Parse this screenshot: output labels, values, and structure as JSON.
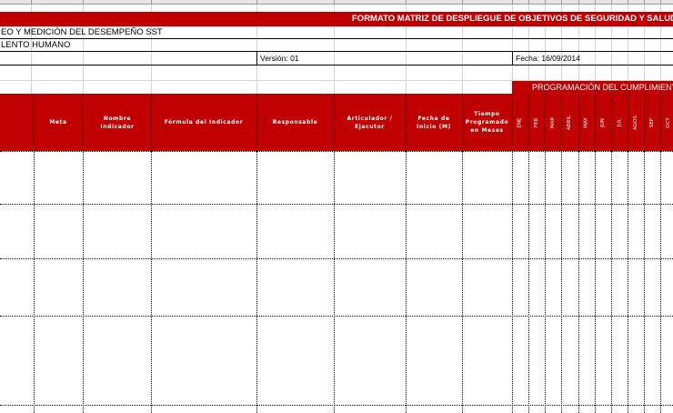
{
  "sheet": {
    "title": "FORMATO MATRIZ DE DESPLIEGUE DE OBJETIVOS DE SEGURIDAD Y SALUD EN EL TRABAJO",
    "row2": "EO Y MEDICIÓN DEL DESEMPEÑO SST",
    "row3": "LENTO HUMANO",
    "version": "Versión: 01",
    "fecha": "Fecha: 16/09/2014",
    "programacion": "PROGRAMACIÓN DEL CUMPLIMIENTO"
  },
  "headers": {
    "meta": "Meta",
    "nombre": "Nombre Indicador",
    "formula": "Fórmula del Indicador",
    "responsable": "Responsable",
    "articulador": "Articulador / Ejecutor",
    "fecha_inicio": "Fecha de Inicio (M)",
    "tiempo": "Tiempo Programado en Meses"
  },
  "months": [
    "ENE",
    "FEB",
    "MAR",
    "ABRIL",
    "MAY",
    "JUN",
    "JUL",
    "AGOS",
    "SEP",
    "OCT"
  ],
  "colors": {
    "accent": "#c00000"
  }
}
